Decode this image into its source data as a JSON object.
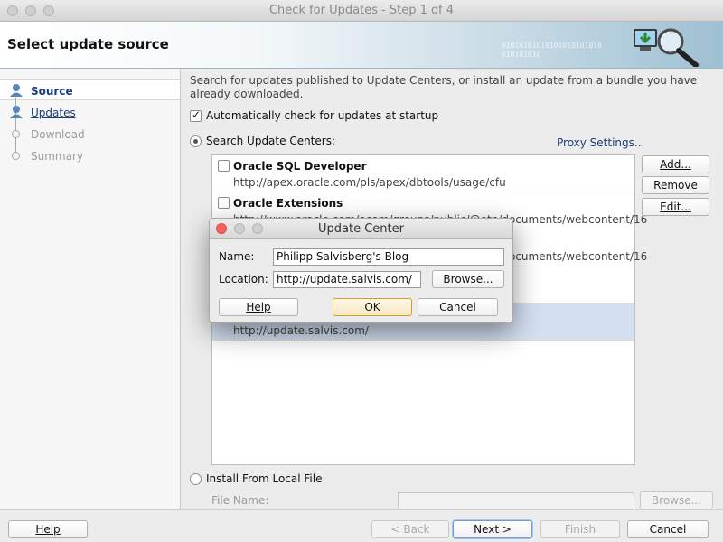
{
  "window": {
    "title": "Check for Updates - Step 1 of 4"
  },
  "header": {
    "title": "Select update source",
    "binary_text": "01010101010101010101010\n010101010"
  },
  "sidebar": {
    "steps": [
      {
        "label": "Source",
        "state": "active"
      },
      {
        "label": "Updates",
        "state": "link"
      },
      {
        "label": "Download",
        "state": "disabled"
      },
      {
        "label": "Summary",
        "state": "disabled"
      }
    ]
  },
  "main": {
    "description": "Search for updates published to Update Centers, or install an update from a bundle you have already downloaded.",
    "auto_check": {
      "label": "Automatically check for updates at startup",
      "checked": true
    },
    "search_centers": {
      "label": "Search Update Centers:",
      "selected": true
    },
    "proxy_link": "Proxy Settings...",
    "update_centers": [
      {
        "name": "Oracle SQL Developer",
        "url": "http://apex.oracle.com/pls/apex/dbtools/usage/cfu",
        "checked": false
      },
      {
        "name": "Oracle Extensions",
        "url": "http://www.oracle.com/ocom/groups/public/@otn/documents/webcontent/16",
        "checked": false
      },
      {
        "name": "",
        "url": "http://www.oracle.com/ocom/groups/public/@otn/documents/webcontent/16",
        "checked": false
      },
      {
        "name": "",
        "url": "",
        "checked": false
      },
      {
        "name": "",
        "url": "http://update.salvis.com/",
        "checked": false
      }
    ],
    "side_buttons": {
      "add": "Add...",
      "remove": "Remove",
      "edit": "Edit..."
    },
    "install_local": {
      "label": "Install From Local File",
      "selected": false
    },
    "file_name": {
      "label": "File Name:",
      "value": ""
    },
    "browse_label": "Browse..."
  },
  "footer": {
    "help": "Help",
    "back": "< Back",
    "next": "Next >",
    "finish": "Finish",
    "cancel": "Cancel"
  },
  "dialog": {
    "title": "Update Center",
    "name_label": "Name:",
    "name_value": "Philipp Salvisberg's Blog",
    "location_label": "Location:",
    "location_value": "http://update.salvis.com/",
    "browse": "Browse...",
    "help": "Help",
    "ok": "OK",
    "cancel": "Cancel"
  },
  "colors": {
    "link": "#1a3d7c",
    "close": "#fc605c",
    "selection": "#d4dff0",
    "default_button": "#d0a020"
  }
}
